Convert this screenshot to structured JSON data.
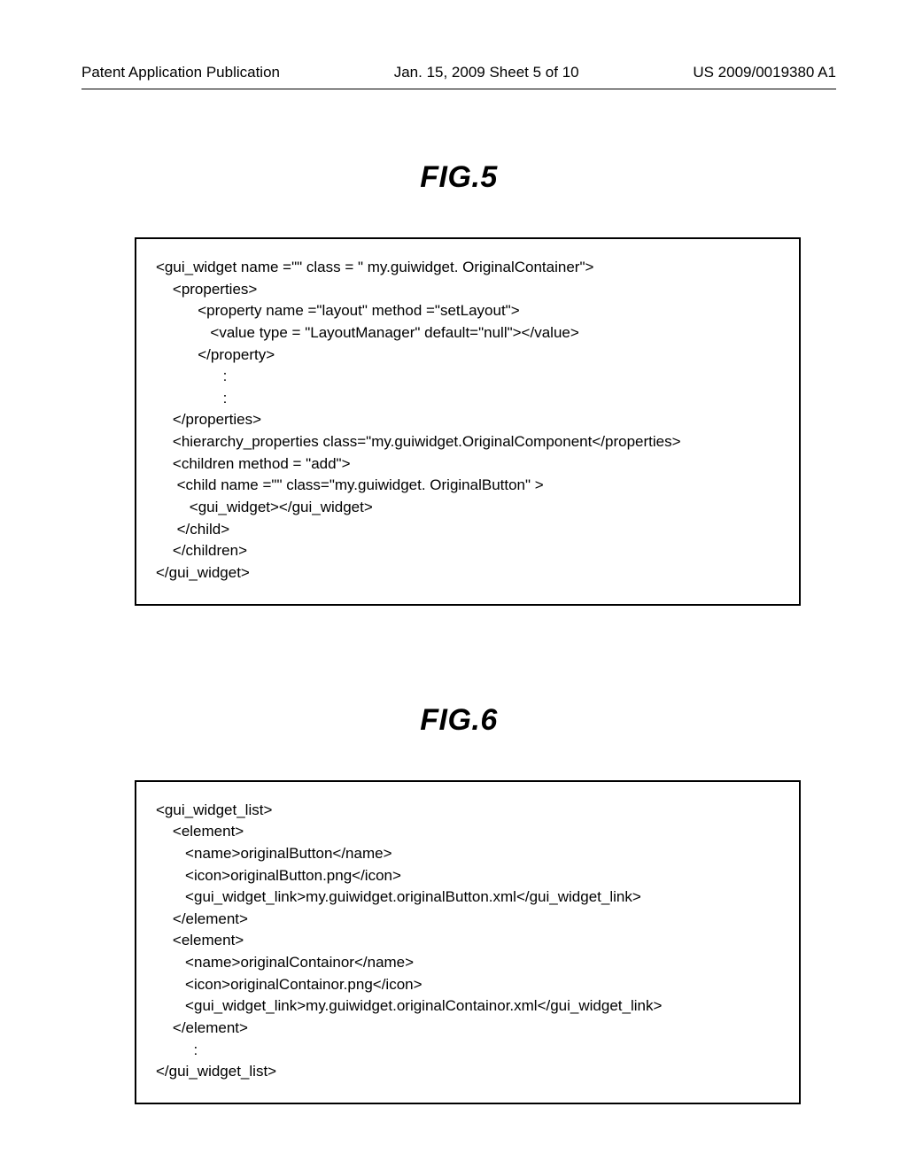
{
  "header": {
    "left": "Patent Application Publication",
    "mid": "Jan. 15, 2009  Sheet 5 of 10",
    "right": "US 2009/0019380 A1"
  },
  "fig5": {
    "title": "FIG.5",
    "code": "<gui_widget name =\"\" class = \" my.guiwidget. OriginalContainer\">\n    <properties>\n          <property name =\"layout\" method =\"setLayout\">\n             <value type = \"LayoutManager\" default=\"null\"></value>\n          </property>\n                :\n                :\n    </properties>\n    <hierarchy_properties class=\"my.guiwidget.OriginalComponent</properties>\n    <children method = \"add\">\n     <child name =\"\" class=\"my.guiwidget. OriginalButton\" >\n        <gui_widget></gui_widget>\n     </child>\n    </children>\n</gui_widget>"
  },
  "fig6": {
    "title": "FIG.6",
    "code": "<gui_widget_list>\n    <element>\n       <name>originalButton</name>\n       <icon>originalButton.png</icon>\n       <gui_widget_link>my.guiwidget.originalButton.xml</gui_widget_link>\n    </element>\n    <element>\n       <name>originalContainor</name>\n       <icon>originalContainor.png</icon>\n       <gui_widget_link>my.guiwidget.originalContainor.xml</gui_widget_link>\n    </element>\n         :\n</gui_widget_list>"
  }
}
